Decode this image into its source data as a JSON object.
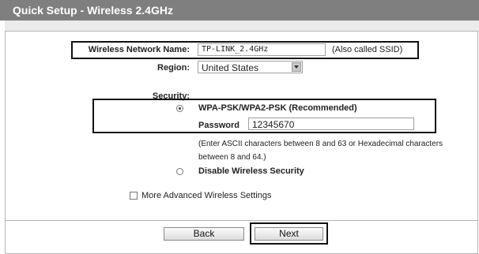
{
  "header": {
    "title": "Quick Setup - Wireless 2.4GHz"
  },
  "wireless_name": {
    "label": "Wireless Network Name:",
    "value": "TP-LINK_2.4GHz",
    "note": "(Also called SSID)"
  },
  "region": {
    "label": "Region:",
    "selected": "United States"
  },
  "security": {
    "label": "Security:",
    "option_wpa": {
      "label": "WPA-PSK/WPA2-PSK (Recommended)",
      "selected": true
    },
    "password": {
      "label": "Password",
      "value": "12345670"
    },
    "hint_line1": "(Enter ASCII characters between 8 and 63 or Hexadecimal characters",
    "hint_line2": "between 8 and 64.)",
    "option_disable": {
      "label": "Disable Wireless Security",
      "selected": false
    }
  },
  "advanced": {
    "label": "More Advanced Wireless Settings",
    "checked": false
  },
  "buttons": {
    "back": "Back",
    "next": "Next"
  }
}
